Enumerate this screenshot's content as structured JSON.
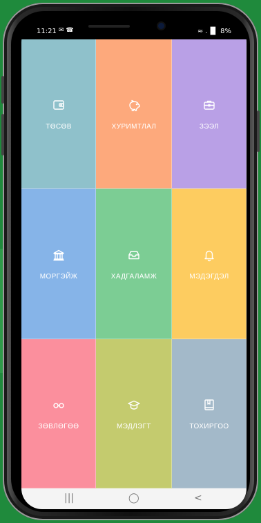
{
  "status_bar": {
    "time": "11:21",
    "left_icons": "✉ ☎",
    "right_text": "≈ .▐▌ 8%"
  },
  "tiles": [
    {
      "label": "ТӨСӨВ",
      "color": "#8fc1cb",
      "icon": "wallet-icon"
    },
    {
      "label": "ХУРИМТЛАЛ",
      "color": "#fda97c",
      "icon": "piggy-bank-icon"
    },
    {
      "label": "ЗЭЭЛ",
      "color": "#b9a0e6",
      "icon": "briefcase-icon"
    },
    {
      "label": "МОРГЭЙЖ",
      "color": "#86b4e8",
      "icon": "bank-icon"
    },
    {
      "label": "ХАДГАЛАМЖ",
      "color": "#7ccd94",
      "icon": "inbox-icon"
    },
    {
      "label": "МЭДЭГДЭЛ",
      "color": "#fdcc60",
      "icon": "bell-icon"
    },
    {
      "label": "ЗӨВЛӨГӨӨ",
      "color": "#fb8f9d",
      "icon": "glasses-icon"
    },
    {
      "label": "МЭДЛЭГТ",
      "color": "#c4cb6e",
      "icon": "graduation-cap-icon"
    },
    {
      "label": "ТОХИРГОО",
      "color": "#a3b9c9",
      "icon": "book-icon"
    }
  ],
  "nav_bar": {
    "recents": "|||",
    "home": "◯",
    "back": "<"
  }
}
